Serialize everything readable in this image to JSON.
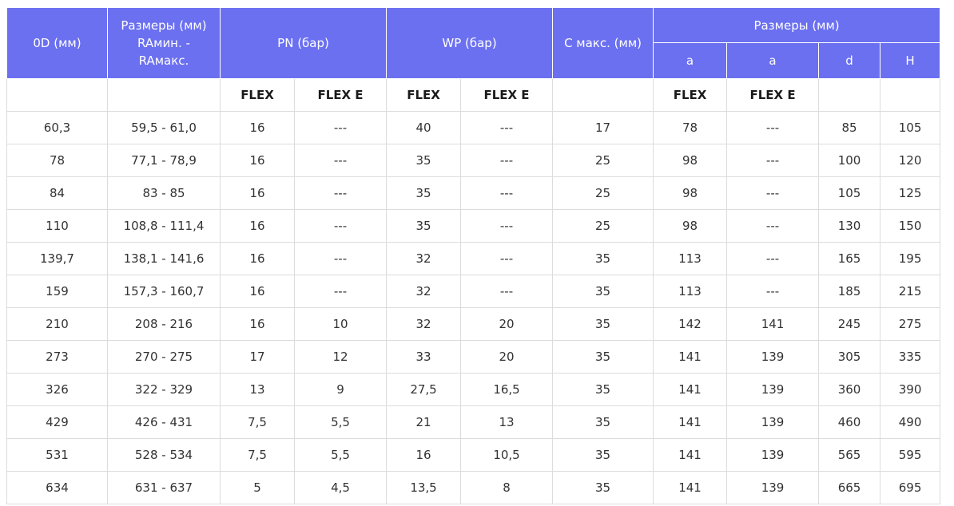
{
  "headers": {
    "od": "0D (мм)",
    "ra": "Размеры (мм) RAмин. - RAмакс.",
    "pn": "PN (бар)",
    "wp": "WP (бар)",
    "c_max": "C макс. (мм)",
    "dims": "Размеры (мм)",
    "sub_a1": "a",
    "sub_a2": "a",
    "sub_d": "d",
    "sub_h": "H"
  },
  "variants": {
    "pn_flex": "FLEX",
    "pn_flex_e": "FLEX E",
    "wp_flex": "FLEX",
    "wp_flex_e": "FLEX E",
    "a_flex": "FLEX",
    "a_flex_e": "FLEX E"
  },
  "rows": [
    [
      "60,3",
      "59,5 - 61,0",
      "16",
      "---",
      "40",
      "---",
      "17",
      "78",
      "---",
      "85",
      "105"
    ],
    [
      "78",
      "77,1 - 78,9",
      "16",
      "---",
      "35",
      "---",
      "25",
      "98",
      "---",
      "100",
      "120"
    ],
    [
      "84",
      "83 - 85",
      "16",
      "---",
      "35",
      "---",
      "25",
      "98",
      "---",
      "105",
      "125"
    ],
    [
      "110",
      "108,8 - 111,4",
      "16",
      "---",
      "35",
      "---",
      "25",
      "98",
      "---",
      "130",
      "150"
    ],
    [
      "139,7",
      "138,1 - 141,6",
      "16",
      "---",
      "32",
      "---",
      "35",
      "113",
      "---",
      "165",
      "195"
    ],
    [
      "159",
      "157,3 - 160,7",
      "16",
      "---",
      "32",
      "---",
      "35",
      "113",
      "---",
      "185",
      "215"
    ],
    [
      "210",
      "208 - 216",
      "16",
      "10",
      "32",
      "20",
      "35",
      "142",
      "141",
      "245",
      "275"
    ],
    [
      "273",
      "270 - 275",
      "17",
      "12",
      "33",
      "20",
      "35",
      "141",
      "139",
      "305",
      "335"
    ],
    [
      "326",
      "322 - 329",
      "13",
      "9",
      "27,5",
      "16,5",
      "35",
      "141",
      "139",
      "360",
      "390"
    ],
    [
      "429",
      "426 - 431",
      "7,5",
      "5,5",
      "21",
      "13",
      "35",
      "141",
      "139",
      "460",
      "490"
    ],
    [
      "531",
      "528 - 534",
      "7,5",
      "5,5",
      "16",
      "10,5",
      "35",
      "141",
      "139",
      "565",
      "595"
    ],
    [
      "634",
      "631 - 637",
      "5",
      "4,5",
      "13,5",
      "8",
      "35",
      "141",
      "139",
      "665",
      "695"
    ]
  ]
}
